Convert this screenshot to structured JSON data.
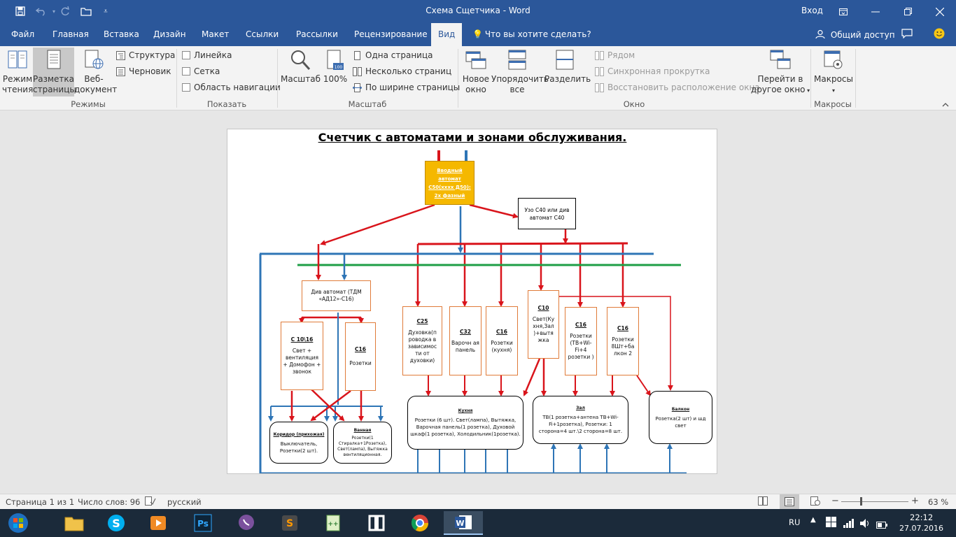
{
  "titlebar": {
    "doc_title": "Схема Сщетчика - Word",
    "sign_in": "Вход"
  },
  "tabs": [
    {
      "label": "Файл"
    },
    {
      "label": "Главная"
    },
    {
      "label": "Вставка"
    },
    {
      "label": "Дизайн"
    },
    {
      "label": "Макет"
    },
    {
      "label": "Ссылки"
    },
    {
      "label": "Рассылки"
    },
    {
      "label": "Рецензирование"
    },
    {
      "label": "Вид"
    }
  ],
  "tell_me": "Что вы хотите сделать?",
  "share": "Общий доступ",
  "ribbon": {
    "modes": {
      "read": "Режим чтения",
      "read_l1": "Режим",
      "read_l2": "чтения",
      "layout_l1": "Разметка",
      "layout_l2": "страницы",
      "web_l1": "Веб-",
      "web_l2": "документ",
      "outline": "Структура",
      "draft": "Черновик",
      "label": "Режимы"
    },
    "show": {
      "ruler": "Линейка",
      "grid": "Сетка",
      "nav": "Область навигации",
      "label": "Показать"
    },
    "zoom": {
      "zoom": "Масштаб",
      "hundred": "100%",
      "one_page": "Одна страница",
      "multi_page": "Несколько страниц",
      "page_width": "По ширине страницы",
      "label": "Масштаб"
    },
    "window": {
      "new_l1": "Новое",
      "new_l2": "окно",
      "arrange_l1": "Упорядочить",
      "arrange_l2": "все",
      "split": "Разделить",
      "side": "Рядом",
      "sync": "Синхронная прокрутка",
      "reset": "Восстановить расположение окна",
      "switch_l1": "Перейти в",
      "switch_l2": "другое окно",
      "label": "Окно"
    },
    "macros": {
      "macros": "Макросы",
      "label": "Макросы"
    }
  },
  "document": {
    "title": "Счетчик с автоматами и зонами обслуживания.",
    "main_breaker": [
      "Вводный",
      "автомат",
      "С50(хххх Д50):",
      "2х фазный"
    ],
    "uzo": "Узо С40 или див автомат С40",
    "div_breaker": "Див автомат (ТДМ «АД12»-С16)",
    "c10_16": {
      "title": "С 10\\16",
      "text": "Свет + вентиляция + Домофон + звонок"
    },
    "c16_a": {
      "title": "С16",
      "text": "Розетки"
    },
    "c25": {
      "title": "С25",
      "text": "Духовка(п роводка в зависимос ти от духовки)"
    },
    "c32": {
      "title": "С32",
      "text": "Варочн ая панель"
    },
    "c16_b": {
      "title": "С16",
      "text": "Розетки (кухня)"
    },
    "c10": {
      "title": "С10",
      "text": "Свет(Ку хня,Зал )+вытя жка"
    },
    "c16_c": {
      "title": "С16",
      "text": "Розетки (ТВ+Wi-Fi+4 розетки )"
    },
    "c16_d": {
      "title": "С16",
      "text": "Розетки 8Шт+ба лкон 2"
    },
    "corridor": {
      "title": "Коридор (прихожая)",
      "text": "Выключатель, Розетки(2 шт)."
    },
    "bathroom": {
      "title": "Ванная",
      "text": "Розетки(1 Стиралка+1Розетка), Свет(лампа), Вытяжка вентиляционная."
    },
    "kitchen": {
      "title": "Кухня",
      "text": "Розетки (6 шт). Свет(лампа), Вытяжка, Варочная панель(1 розетка), Духовой шкаф(1 розетка), Холодильник(1розетка)."
    },
    "hall": {
      "title": "Зал",
      "text": "ТВ(1 розетка+антена ТВ+Wi-Fi+1розетка), Розетки: 1 сторона=4 шт.\\2 сторона=8 шт."
    },
    "balcony": {
      "title": "Балкон",
      "text": "Розетка(2 шт) и шд свет"
    }
  },
  "status": {
    "page": "Страница 1 из 1",
    "words": "Число слов: 96",
    "lang": "русский",
    "zoom": "63 %"
  },
  "taskbar": {
    "lang": "RU",
    "time": "22:12",
    "date": "27.07.2016"
  },
  "colors": {
    "accent": "#2b579a",
    "wire_red": "#d9141b",
    "wire_blue": "#2e75b6",
    "wire_green": "#1e9e46",
    "main_breaker_fill": "#f5b800"
  }
}
